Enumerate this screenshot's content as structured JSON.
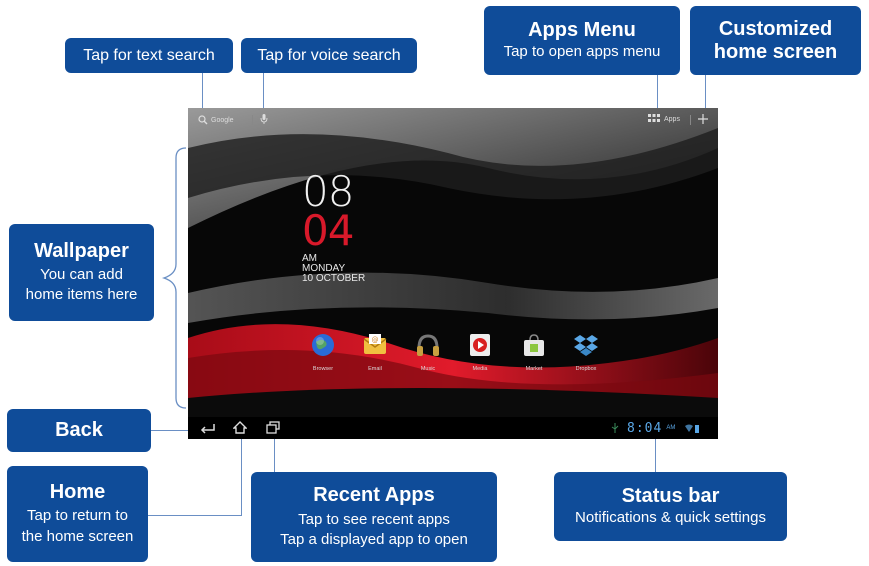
{
  "callouts": {
    "text_search": {
      "label": "Tap for text search"
    },
    "voice_search": {
      "label": "Tap for voice search"
    },
    "apps_menu": {
      "title": "Apps Menu",
      "sub": "Tap to open apps menu"
    },
    "customized": {
      "line1": "Customized",
      "line2": "home screen"
    },
    "wallpaper": {
      "title": "Wallpaper",
      "line1": "You can add",
      "line2": "home items here"
    },
    "back": {
      "title": "Back"
    },
    "home": {
      "title": "Home",
      "line1": "Tap to return to",
      "line2": "the home screen"
    },
    "recent": {
      "title": "Recent Apps",
      "line1": "Tap to see recent apps",
      "line2": "Tap a displayed app to open"
    },
    "status": {
      "title": "Status bar",
      "sub": "Notifications & quick settings"
    }
  },
  "tablet": {
    "search_label": "Google",
    "apps_label": "Apps",
    "clock": {
      "hour": "08",
      "minute": "04",
      "ampm": "AM",
      "day": "MONDAY",
      "date": "10 OCTOBER"
    },
    "apps": [
      {
        "label": "Browser",
        "icon": "globe-icon",
        "color": "#2a6bd6"
      },
      {
        "label": "Email",
        "icon": "email-icon",
        "color": "#f0c040"
      },
      {
        "label": "Music",
        "icon": "headphones-icon",
        "color": "#c8a040"
      },
      {
        "label": "Media",
        "icon": "play-icon",
        "color": "#d82020"
      },
      {
        "label": "Market",
        "icon": "market-bag-icon",
        "color": "#8cc63f"
      },
      {
        "label": "Dropbox",
        "icon": "dropbox-icon",
        "color": "#5aa7e6"
      }
    ],
    "status_time": "8:04",
    "status_ampm": "AM"
  },
  "colors": {
    "callout_bg": "#0f4c99",
    "accent_red": "#d8192a"
  }
}
